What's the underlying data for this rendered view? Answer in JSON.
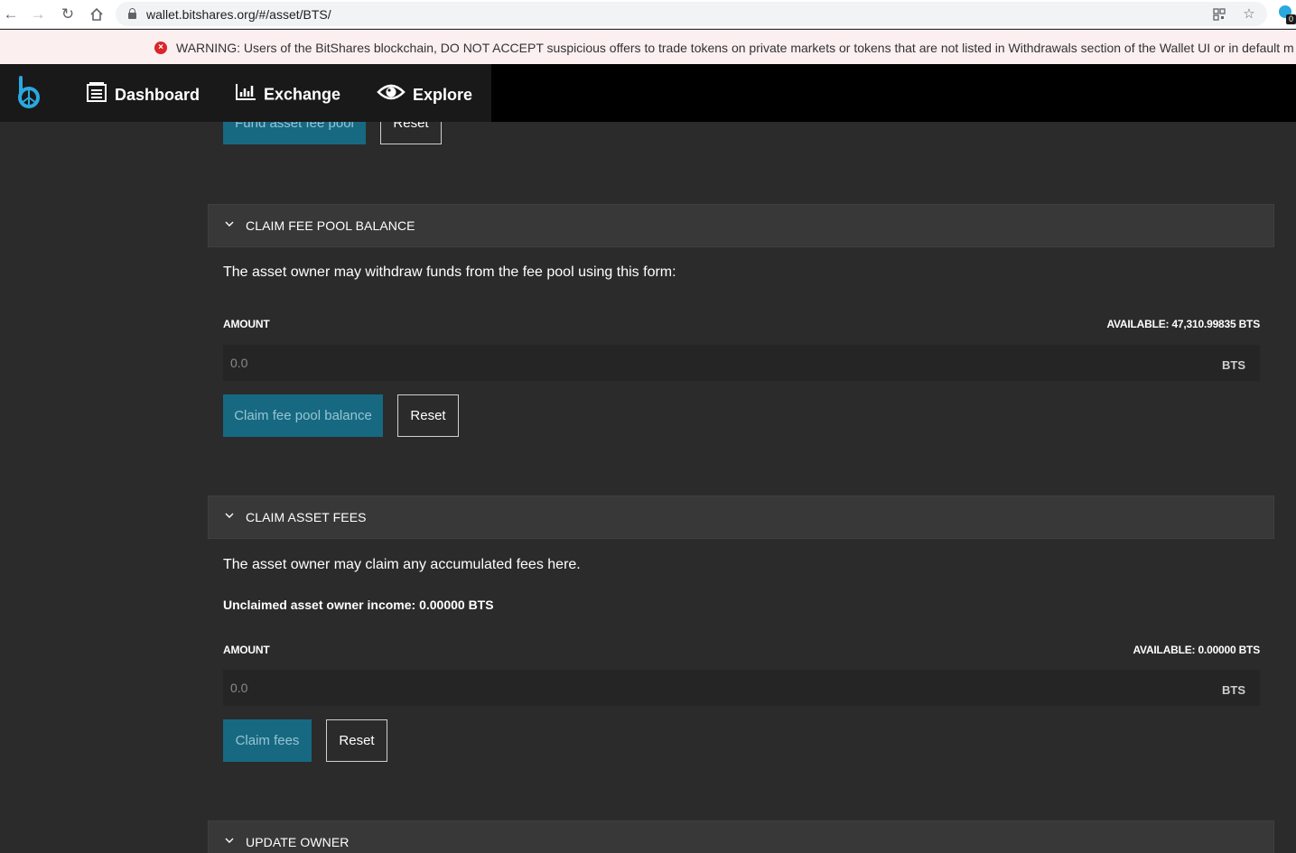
{
  "browser": {
    "url": "wallet.bitshares.org/#/asset/BTS/",
    "extension_badge": "0"
  },
  "warning": {
    "text": "WARNING: Users of the BitShares blockchain, DO NOT ACCEPT suspicious offers to trade tokens on private markets or tokens that are not listed in Withdrawals section of the Wallet UI or in default m"
  },
  "header": {
    "menu": [
      {
        "label": "Dashboard",
        "icon": "dashboard-icon"
      },
      {
        "label": "Exchange",
        "icon": "exchange-chart-icon"
      },
      {
        "label": "Explore",
        "icon": "eye-icon"
      }
    ]
  },
  "fund_pool": {
    "submit_label": "Fund asset fee pool",
    "reset_label": "Reset"
  },
  "claim_pool": {
    "title": "CLAIM FEE POOL BALANCE",
    "description": "The asset owner may withdraw funds from the fee pool using this form:",
    "amount_label": "AMOUNT",
    "available": "AVAILABLE: 47,310.99835 BTS",
    "placeholder": "0.0",
    "unit": "BTS",
    "submit_label": "Claim fee pool balance",
    "reset_label": "Reset"
  },
  "claim_fees": {
    "title": "CLAIM ASSET FEES",
    "description": "The asset owner may claim any accumulated fees here.",
    "income": "Unclaimed asset owner income: 0.00000 BTS",
    "amount_label": "AMOUNT",
    "available": "AVAILABLE: 0.00000 BTS",
    "placeholder": "0.0",
    "unit": "BTS",
    "submit_label": "Claim fees",
    "reset_label": "Reset"
  },
  "update_owner": {
    "title": "UPDATE OWNER"
  },
  "colors": {
    "accent": "#176982",
    "background": "#2b2b2b",
    "header": "#191919",
    "warning_bg": "#fbeff0",
    "warning_icon": "#d9262c"
  }
}
